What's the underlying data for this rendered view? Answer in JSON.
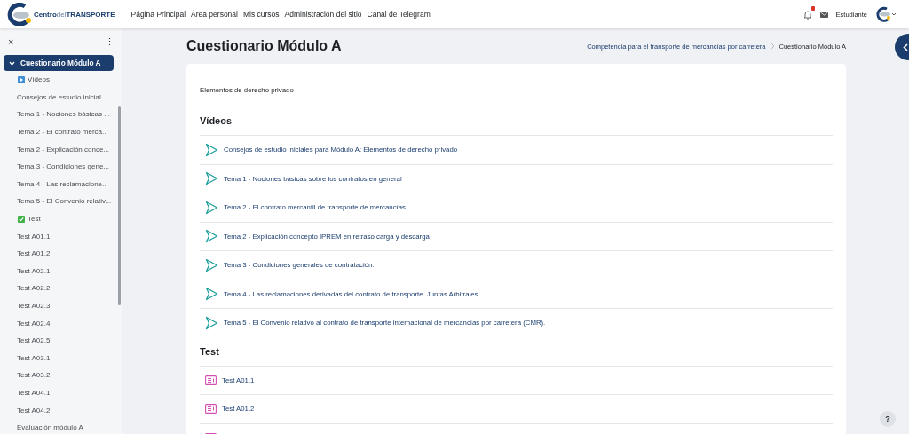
{
  "navbar": {
    "logo_parts": [
      "Centro",
      "del",
      "TRANSPORTE"
    ],
    "links": [
      "Página Principal",
      "Área personal",
      "Mis cursos",
      "Administración del sitio",
      "Canal de Telegram"
    ],
    "user_name": "Estudiante"
  },
  "course_index": {
    "close_label": "×",
    "menu_label": "⋮",
    "section": {
      "title": "Cuestionario Módulo A",
      "expanded": true,
      "selected": true
    },
    "items": [
      {
        "kind": "videos-heading",
        "label": "Vídeos"
      },
      {
        "kind": "activity",
        "label": "Consejos de estudio inicial..."
      },
      {
        "kind": "activity",
        "label": "Tema 1 - Nociones básicas ..."
      },
      {
        "kind": "activity",
        "label": "Tema 2 - El contrato merca..."
      },
      {
        "kind": "activity",
        "label": "Tema 2 - Explicación conce..."
      },
      {
        "kind": "activity",
        "label": "Tema 3 - Condiciones gene..."
      },
      {
        "kind": "activity",
        "label": "Tema 4 - Las reclamacione..."
      },
      {
        "kind": "activity",
        "label": "Tema 5 - El Convenio relativ..."
      },
      {
        "kind": "test-heading",
        "label": "Test"
      },
      {
        "kind": "activity",
        "label": "Test A01.1"
      },
      {
        "kind": "activity",
        "label": "Test A01.2"
      },
      {
        "kind": "activity",
        "label": "Test A02.1"
      },
      {
        "kind": "activity",
        "label": "Test A02.2"
      },
      {
        "kind": "activity",
        "label": "Test A02.3"
      },
      {
        "kind": "activity",
        "label": "Test A02.4"
      },
      {
        "kind": "activity",
        "label": "Test A02.5"
      },
      {
        "kind": "activity",
        "label": "Test A03.1"
      },
      {
        "kind": "activity",
        "label": "Test A03.2"
      },
      {
        "kind": "activity",
        "label": "Test A04.1"
      },
      {
        "kind": "activity",
        "label": "Test A04.2"
      },
      {
        "kind": "activity",
        "label": "Evaluación módulo A"
      }
    ]
  },
  "page": {
    "title": "Cuestionario Módulo A",
    "breadcrumb": [
      "Competencia para el transporte de mercancías por carretera",
      "Cuestionario Módulo A"
    ],
    "summary": "Elementos de derecho privado",
    "sections": [
      {
        "title": "Vídeos",
        "activities": [
          {
            "kind": "video",
            "label": "Consejos de estudio iniciales para Módulo A: Elementos de derecho privado"
          },
          {
            "kind": "video",
            "label": "Tema 1 - Nociones básicas sobre los contratos en general"
          },
          {
            "kind": "video",
            "label": "Tema 2 - El contrato mercantil de transporte de mercancías."
          },
          {
            "kind": "video",
            "label": "Tema 2 - Explicación concepto IPREM en retraso carga y descarga"
          },
          {
            "kind": "video",
            "label": "Tema 3 - Condiciones generales de contratación."
          },
          {
            "kind": "video",
            "label": "Tema 4 - Las reclamaciones derivadas del contrato de transporte. Juntas Arbitrales"
          },
          {
            "kind": "video",
            "label": "Tema 5 - El Convenio relativo al contrato de transporte internacional de mercancías por carretera (CMR)."
          }
        ]
      },
      {
        "title": "Test",
        "activities": [
          {
            "kind": "quiz",
            "label": "Test A01.1"
          },
          {
            "kind": "quiz",
            "label": "Test A01.2"
          }
        ]
      }
    ]
  },
  "help_label": "?"
}
